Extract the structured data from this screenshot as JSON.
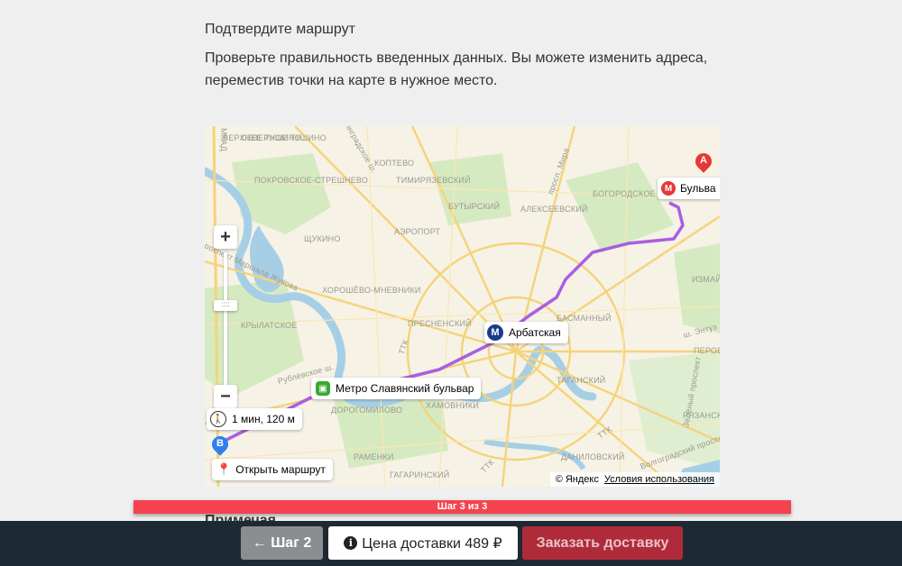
{
  "page": {
    "heading": "Подтвердите маршрут",
    "description": "Проверьте правильность введенных данных. Вы можете изменить адреса, переместив точки на карте в нужное место.",
    "subheading": "Примечая"
  },
  "map": {
    "districts": [
      "ВЕРХНЕЕ ТУШИНО",
      "СЕВЕРНОЕ ТУШИНО",
      "ПОКРОВСКОЕ-СТРЕШНЕВО",
      "ЩУКИНО",
      "ХОРОШЁВО-МНЕВНИКИ",
      "КРЫЛАТСКОЕ",
      "КОПТЕВО",
      "ТИМИРЯЗЕВСКИЙ",
      "БУТЫРСКИЙ",
      "АЭРОПОРТ",
      "АЛЕКСЕЕВСКИЙ",
      "БОГОРОДСКОЕ",
      "ПРЕСНЕНСКИЙ",
      "БАСМАННЫЙ",
      "ТАГАНСКИЙ",
      "ХАМОВНИКИ",
      "ДАНИЛОВСКИЙ",
      "РАМЕНКИ",
      "ГАГАРИНСКИЙ",
      "ДОРОГОМИЛОВО",
      "РЯЗАНСКИЙ",
      "ИЗМАЙ",
      "ПЕРОВ",
      "ТТК",
      "ТТК",
      "ТТК",
      "просп. Мира",
      "Волгоградский проспект",
      "ш. Энтуз",
      "проспект Маршала Жукова",
      "Рублёвское ш.",
      "Зелёный проспект",
      "МКАД",
      "Ленинградское ш."
    ],
    "metro_arbatskaya": "Арбатская",
    "stop_label": "Метро Славянский бульвар",
    "walk_info": "1 мин, 120 м",
    "point_a": "A",
    "point_b": "B",
    "bulvar_label": "Бульва",
    "open_route": "Открыть маршрут",
    "copyright": "© Яндекс",
    "terms": "Условия использования",
    "zoom_in": "+",
    "zoom_out": "−",
    "route_color": "#a860e0"
  },
  "progress": {
    "label": "Шаг 3 из 3",
    "current_step": 3,
    "total_steps": 3
  },
  "footer": {
    "back_label": "← Шаг 2",
    "price_label": "Цена доставки 489 ₽",
    "order_label": "Заказать доставку"
  },
  "colors": {
    "accent": "#f4434e",
    "footer_bg": "#1e2a33",
    "order_btn": "#b02b3a"
  }
}
